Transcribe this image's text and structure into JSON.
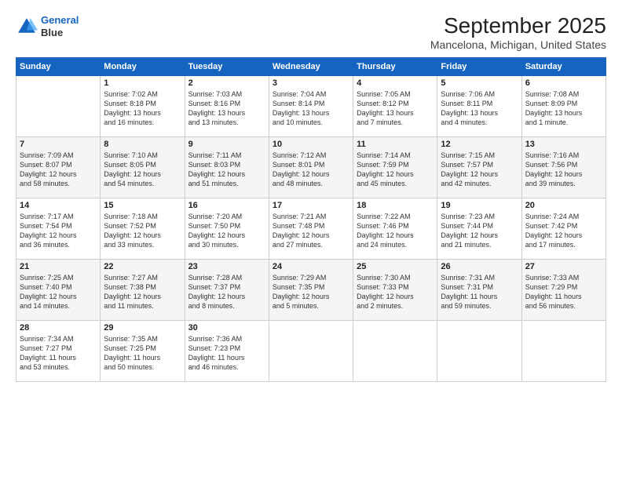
{
  "logo": {
    "line1": "General",
    "line2": "Blue"
  },
  "title": "September 2025",
  "subtitle": "Mancelona, Michigan, United States",
  "days_header": [
    "Sunday",
    "Monday",
    "Tuesday",
    "Wednesday",
    "Thursday",
    "Friday",
    "Saturday"
  ],
  "weeks": [
    [
      {
        "day": "",
        "info": ""
      },
      {
        "day": "1",
        "info": "Sunrise: 7:02 AM\nSunset: 8:18 PM\nDaylight: 13 hours\nand 16 minutes."
      },
      {
        "day": "2",
        "info": "Sunrise: 7:03 AM\nSunset: 8:16 PM\nDaylight: 13 hours\nand 13 minutes."
      },
      {
        "day": "3",
        "info": "Sunrise: 7:04 AM\nSunset: 8:14 PM\nDaylight: 13 hours\nand 10 minutes."
      },
      {
        "day": "4",
        "info": "Sunrise: 7:05 AM\nSunset: 8:12 PM\nDaylight: 13 hours\nand 7 minutes."
      },
      {
        "day": "5",
        "info": "Sunrise: 7:06 AM\nSunset: 8:11 PM\nDaylight: 13 hours\nand 4 minutes."
      },
      {
        "day": "6",
        "info": "Sunrise: 7:08 AM\nSunset: 8:09 PM\nDaylight: 13 hours\nand 1 minute."
      }
    ],
    [
      {
        "day": "7",
        "info": "Sunrise: 7:09 AM\nSunset: 8:07 PM\nDaylight: 12 hours\nand 58 minutes."
      },
      {
        "day": "8",
        "info": "Sunrise: 7:10 AM\nSunset: 8:05 PM\nDaylight: 12 hours\nand 54 minutes."
      },
      {
        "day": "9",
        "info": "Sunrise: 7:11 AM\nSunset: 8:03 PM\nDaylight: 12 hours\nand 51 minutes."
      },
      {
        "day": "10",
        "info": "Sunrise: 7:12 AM\nSunset: 8:01 PM\nDaylight: 12 hours\nand 48 minutes."
      },
      {
        "day": "11",
        "info": "Sunrise: 7:14 AM\nSunset: 7:59 PM\nDaylight: 12 hours\nand 45 minutes."
      },
      {
        "day": "12",
        "info": "Sunrise: 7:15 AM\nSunset: 7:57 PM\nDaylight: 12 hours\nand 42 minutes."
      },
      {
        "day": "13",
        "info": "Sunrise: 7:16 AM\nSunset: 7:56 PM\nDaylight: 12 hours\nand 39 minutes."
      }
    ],
    [
      {
        "day": "14",
        "info": "Sunrise: 7:17 AM\nSunset: 7:54 PM\nDaylight: 12 hours\nand 36 minutes."
      },
      {
        "day": "15",
        "info": "Sunrise: 7:18 AM\nSunset: 7:52 PM\nDaylight: 12 hours\nand 33 minutes."
      },
      {
        "day": "16",
        "info": "Sunrise: 7:20 AM\nSunset: 7:50 PM\nDaylight: 12 hours\nand 30 minutes."
      },
      {
        "day": "17",
        "info": "Sunrise: 7:21 AM\nSunset: 7:48 PM\nDaylight: 12 hours\nand 27 minutes."
      },
      {
        "day": "18",
        "info": "Sunrise: 7:22 AM\nSunset: 7:46 PM\nDaylight: 12 hours\nand 24 minutes."
      },
      {
        "day": "19",
        "info": "Sunrise: 7:23 AM\nSunset: 7:44 PM\nDaylight: 12 hours\nand 21 minutes."
      },
      {
        "day": "20",
        "info": "Sunrise: 7:24 AM\nSunset: 7:42 PM\nDaylight: 12 hours\nand 17 minutes."
      }
    ],
    [
      {
        "day": "21",
        "info": "Sunrise: 7:25 AM\nSunset: 7:40 PM\nDaylight: 12 hours\nand 14 minutes."
      },
      {
        "day": "22",
        "info": "Sunrise: 7:27 AM\nSunset: 7:38 PM\nDaylight: 12 hours\nand 11 minutes."
      },
      {
        "day": "23",
        "info": "Sunrise: 7:28 AM\nSunset: 7:37 PM\nDaylight: 12 hours\nand 8 minutes."
      },
      {
        "day": "24",
        "info": "Sunrise: 7:29 AM\nSunset: 7:35 PM\nDaylight: 12 hours\nand 5 minutes."
      },
      {
        "day": "25",
        "info": "Sunrise: 7:30 AM\nSunset: 7:33 PM\nDaylight: 12 hours\nand 2 minutes."
      },
      {
        "day": "26",
        "info": "Sunrise: 7:31 AM\nSunset: 7:31 PM\nDaylight: 11 hours\nand 59 minutes."
      },
      {
        "day": "27",
        "info": "Sunrise: 7:33 AM\nSunset: 7:29 PM\nDaylight: 11 hours\nand 56 minutes."
      }
    ],
    [
      {
        "day": "28",
        "info": "Sunrise: 7:34 AM\nSunset: 7:27 PM\nDaylight: 11 hours\nand 53 minutes."
      },
      {
        "day": "29",
        "info": "Sunrise: 7:35 AM\nSunset: 7:25 PM\nDaylight: 11 hours\nand 50 minutes."
      },
      {
        "day": "30",
        "info": "Sunrise: 7:36 AM\nSunset: 7:23 PM\nDaylight: 11 hours\nand 46 minutes."
      },
      {
        "day": "",
        "info": ""
      },
      {
        "day": "",
        "info": ""
      },
      {
        "day": "",
        "info": ""
      },
      {
        "day": "",
        "info": ""
      }
    ]
  ]
}
